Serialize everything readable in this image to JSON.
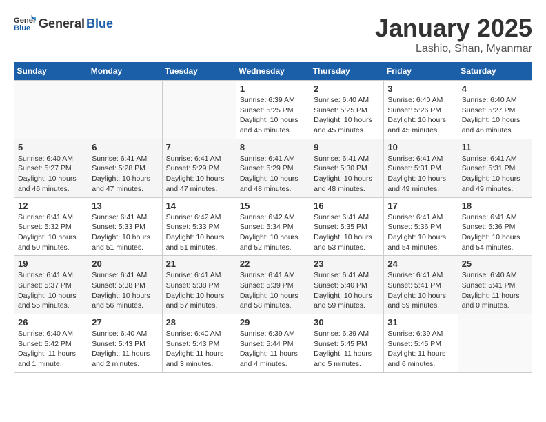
{
  "header": {
    "logo_general": "General",
    "logo_blue": "Blue",
    "title": "January 2025",
    "subtitle": "Lashio, Shan, Myanmar"
  },
  "weekdays": [
    "Sunday",
    "Monday",
    "Tuesday",
    "Wednesday",
    "Thursday",
    "Friday",
    "Saturday"
  ],
  "weeks": [
    [
      {
        "day": "",
        "info": ""
      },
      {
        "day": "",
        "info": ""
      },
      {
        "day": "",
        "info": ""
      },
      {
        "day": "1",
        "info": "Sunrise: 6:39 AM\nSunset: 5:25 PM\nDaylight: 10 hours\nand 45 minutes."
      },
      {
        "day": "2",
        "info": "Sunrise: 6:40 AM\nSunset: 5:25 PM\nDaylight: 10 hours\nand 45 minutes."
      },
      {
        "day": "3",
        "info": "Sunrise: 6:40 AM\nSunset: 5:26 PM\nDaylight: 10 hours\nand 45 minutes."
      },
      {
        "day": "4",
        "info": "Sunrise: 6:40 AM\nSunset: 5:27 PM\nDaylight: 10 hours\nand 46 minutes."
      }
    ],
    [
      {
        "day": "5",
        "info": "Sunrise: 6:40 AM\nSunset: 5:27 PM\nDaylight: 10 hours\nand 46 minutes."
      },
      {
        "day": "6",
        "info": "Sunrise: 6:41 AM\nSunset: 5:28 PM\nDaylight: 10 hours\nand 47 minutes."
      },
      {
        "day": "7",
        "info": "Sunrise: 6:41 AM\nSunset: 5:29 PM\nDaylight: 10 hours\nand 47 minutes."
      },
      {
        "day": "8",
        "info": "Sunrise: 6:41 AM\nSunset: 5:29 PM\nDaylight: 10 hours\nand 48 minutes."
      },
      {
        "day": "9",
        "info": "Sunrise: 6:41 AM\nSunset: 5:30 PM\nDaylight: 10 hours\nand 48 minutes."
      },
      {
        "day": "10",
        "info": "Sunrise: 6:41 AM\nSunset: 5:31 PM\nDaylight: 10 hours\nand 49 minutes."
      },
      {
        "day": "11",
        "info": "Sunrise: 6:41 AM\nSunset: 5:31 PM\nDaylight: 10 hours\nand 49 minutes."
      }
    ],
    [
      {
        "day": "12",
        "info": "Sunrise: 6:41 AM\nSunset: 5:32 PM\nDaylight: 10 hours\nand 50 minutes."
      },
      {
        "day": "13",
        "info": "Sunrise: 6:41 AM\nSunset: 5:33 PM\nDaylight: 10 hours\nand 51 minutes."
      },
      {
        "day": "14",
        "info": "Sunrise: 6:42 AM\nSunset: 5:33 PM\nDaylight: 10 hours\nand 51 minutes."
      },
      {
        "day": "15",
        "info": "Sunrise: 6:42 AM\nSunset: 5:34 PM\nDaylight: 10 hours\nand 52 minutes."
      },
      {
        "day": "16",
        "info": "Sunrise: 6:41 AM\nSunset: 5:35 PM\nDaylight: 10 hours\nand 53 minutes."
      },
      {
        "day": "17",
        "info": "Sunrise: 6:41 AM\nSunset: 5:36 PM\nDaylight: 10 hours\nand 54 minutes."
      },
      {
        "day": "18",
        "info": "Sunrise: 6:41 AM\nSunset: 5:36 PM\nDaylight: 10 hours\nand 54 minutes."
      }
    ],
    [
      {
        "day": "19",
        "info": "Sunrise: 6:41 AM\nSunset: 5:37 PM\nDaylight: 10 hours\nand 55 minutes."
      },
      {
        "day": "20",
        "info": "Sunrise: 6:41 AM\nSunset: 5:38 PM\nDaylight: 10 hours\nand 56 minutes."
      },
      {
        "day": "21",
        "info": "Sunrise: 6:41 AM\nSunset: 5:38 PM\nDaylight: 10 hours\nand 57 minutes."
      },
      {
        "day": "22",
        "info": "Sunrise: 6:41 AM\nSunset: 5:39 PM\nDaylight: 10 hours\nand 58 minutes."
      },
      {
        "day": "23",
        "info": "Sunrise: 6:41 AM\nSunset: 5:40 PM\nDaylight: 10 hours\nand 59 minutes."
      },
      {
        "day": "24",
        "info": "Sunrise: 6:41 AM\nSunset: 5:41 PM\nDaylight: 10 hours\nand 59 minutes."
      },
      {
        "day": "25",
        "info": "Sunrise: 6:40 AM\nSunset: 5:41 PM\nDaylight: 11 hours\nand 0 minutes."
      }
    ],
    [
      {
        "day": "26",
        "info": "Sunrise: 6:40 AM\nSunset: 5:42 PM\nDaylight: 11 hours\nand 1 minute."
      },
      {
        "day": "27",
        "info": "Sunrise: 6:40 AM\nSunset: 5:43 PM\nDaylight: 11 hours\nand 2 minutes."
      },
      {
        "day": "28",
        "info": "Sunrise: 6:40 AM\nSunset: 5:43 PM\nDaylight: 11 hours\nand 3 minutes."
      },
      {
        "day": "29",
        "info": "Sunrise: 6:39 AM\nSunset: 5:44 PM\nDaylight: 11 hours\nand 4 minutes."
      },
      {
        "day": "30",
        "info": "Sunrise: 6:39 AM\nSunset: 5:45 PM\nDaylight: 11 hours\nand 5 minutes."
      },
      {
        "day": "31",
        "info": "Sunrise: 6:39 AM\nSunset: 5:45 PM\nDaylight: 11 hours\nand 6 minutes."
      },
      {
        "day": "",
        "info": ""
      }
    ]
  ]
}
